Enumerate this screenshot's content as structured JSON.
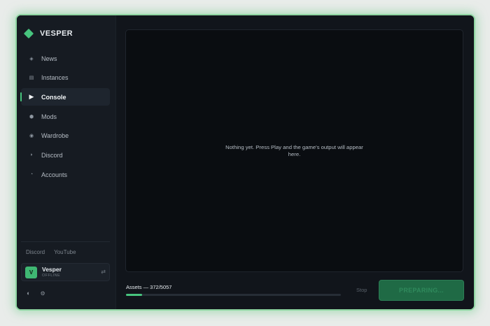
{
  "app": {
    "name": "VESPER"
  },
  "colors": {
    "accent": "#47c47e",
    "background": "#0f1318",
    "sidebar": "#161b22"
  },
  "nav": {
    "items": [
      {
        "label": "News",
        "icon": "news-icon",
        "glyph": "◈",
        "active": false
      },
      {
        "label": "Instances",
        "icon": "instances-icon",
        "glyph": "▤",
        "active": false
      },
      {
        "label": "Console",
        "icon": "play-icon",
        "glyph": "▶",
        "active": true
      },
      {
        "label": "Mods",
        "icon": "mods-icon",
        "glyph": "⬢",
        "active": false
      },
      {
        "label": "Wardrobe",
        "icon": "wardrobe-icon",
        "glyph": "◉",
        "active": false
      },
      {
        "label": "Discord",
        "icon": "discord-icon",
        "glyph": "◗",
        "active": false
      },
      {
        "label": "Accounts",
        "icon": "accounts-icon",
        "glyph": "◔",
        "active": false
      }
    ]
  },
  "links": {
    "discord": "Discord",
    "youtube": "YouTube"
  },
  "account": {
    "initial": "V",
    "name": "Vesper",
    "status": "OFFLINE",
    "swap_icon": "⇄"
  },
  "bottom_icons": {
    "theme": "◐",
    "settings": "⚙"
  },
  "console": {
    "empty_message": "Nothing yet. Press Play and the game's output will appear here."
  },
  "progress": {
    "label": "Assets — 372/5057",
    "current": 372,
    "total": 5057
  },
  "controls": {
    "stop_label": "Stop",
    "launch_label": "PREPARING..."
  }
}
